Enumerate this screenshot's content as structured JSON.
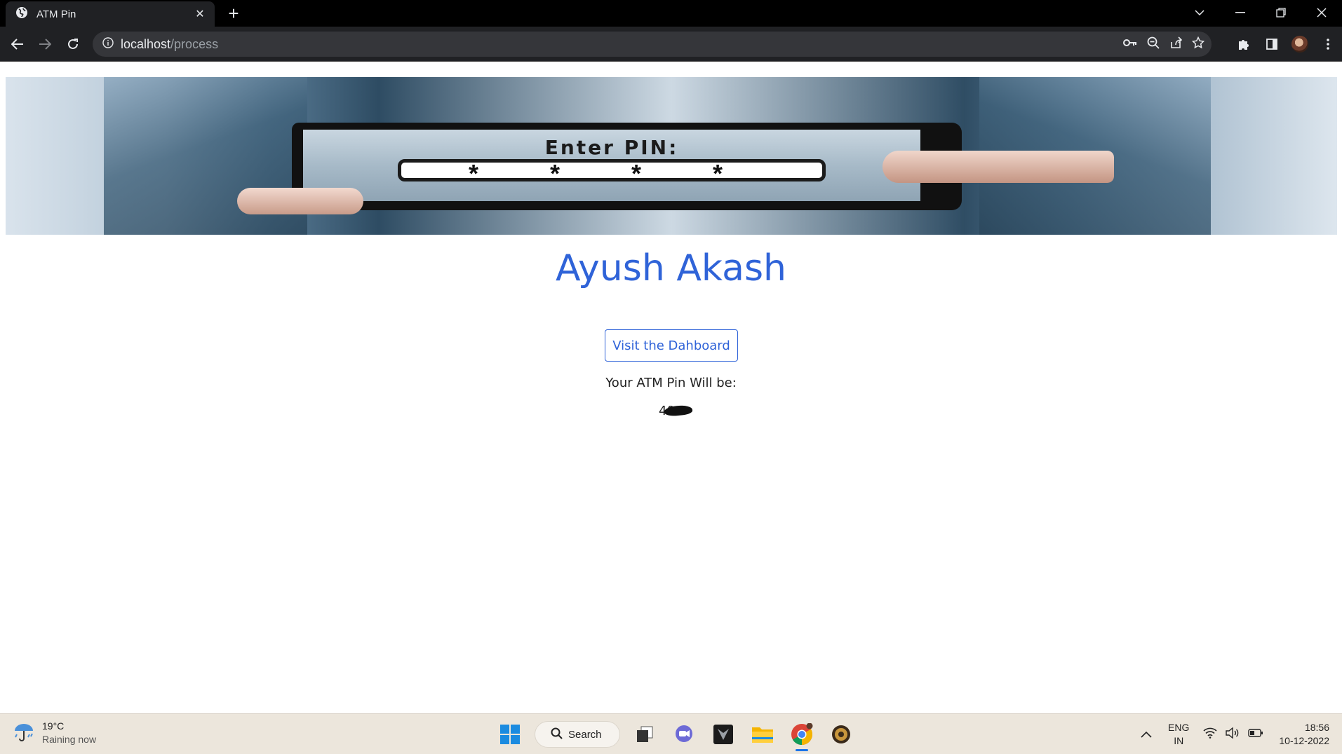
{
  "browser": {
    "tab_title": "ATM Pin",
    "url_host": "localhost",
    "url_path": "/process"
  },
  "banner": {
    "screen_label": "Enter PIN:",
    "mask": "* * * *"
  },
  "content": {
    "name": "Ayush Akash",
    "dashboard_button": "Visit the Dahboard",
    "pin_caption": "Your ATM Pin Will be:",
    "pin_value": "40"
  },
  "taskbar": {
    "temperature": "19°C",
    "weather": "Raining now",
    "search_label": "Search",
    "lang_top": "ENG",
    "lang_bottom": "IN",
    "time": "18:56",
    "date": "10-12-2022"
  },
  "colors": {
    "accent": "#2f63d8",
    "chrome_dark": "#202124",
    "taskbar": "#ece6dc"
  }
}
